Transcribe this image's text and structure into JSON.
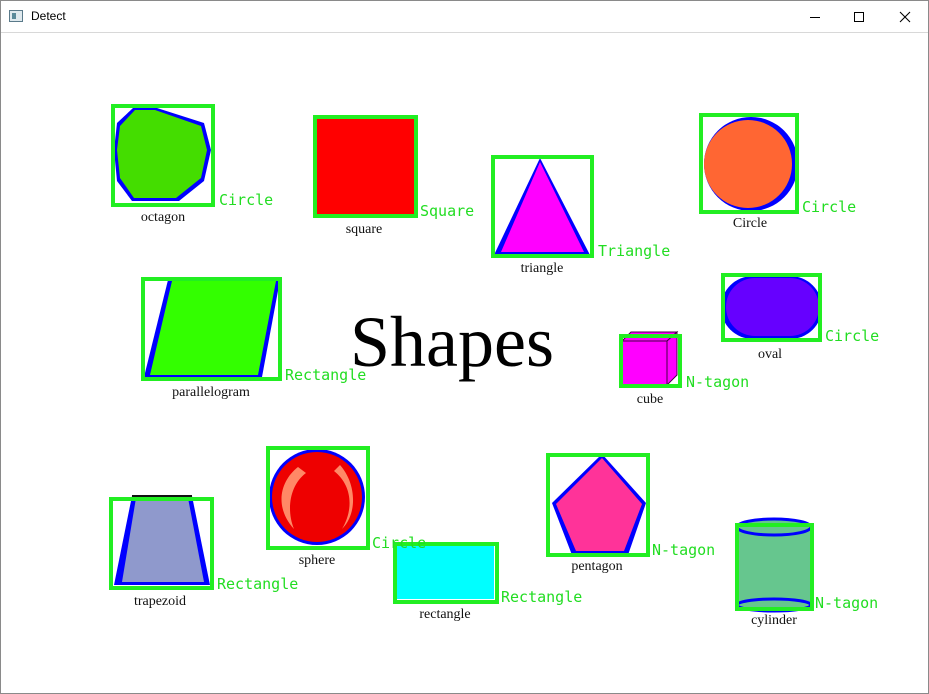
{
  "window": {
    "title": "Detect",
    "controls": [
      "minimize",
      "maximize",
      "close"
    ]
  },
  "canvas": {
    "heading": "Shapes",
    "shapes": [
      {
        "name": "octagon",
        "label": "octagon",
        "detection": "Circle",
        "color": "#44dd00"
      },
      {
        "name": "square",
        "label": "square",
        "detection": "Square",
        "color": "#ff0000"
      },
      {
        "name": "triangle",
        "label": "triangle",
        "detection": "Triangle",
        "color": "#ff00ff"
      },
      {
        "name": "circle",
        "label": "Circle",
        "detection": "Circle",
        "color": "#ff6633"
      },
      {
        "name": "parallelogram",
        "label": "parallelogram",
        "detection": "Rectangle",
        "color": "#33ff00"
      },
      {
        "name": "oval",
        "label": "oval",
        "detection": "Circle",
        "color": "#6600ff"
      },
      {
        "name": "cube",
        "label": "cube",
        "detection": "N-tagon",
        "color": "#ff00ff"
      },
      {
        "name": "sphere",
        "label": "sphere",
        "detection": "Circle",
        "color": "#ee0000"
      },
      {
        "name": "pentagon",
        "label": "pentagon",
        "detection": "N-tagon",
        "color": "#ff3399"
      },
      {
        "name": "trapezoid",
        "label": "trapezoid",
        "detection": "Rectangle",
        "color": "#8f99cc"
      },
      {
        "name": "rectangle",
        "label": "rectangle",
        "detection": "Rectangle",
        "color": "#00ffff"
      },
      {
        "name": "cylinder",
        "label": "cylinder",
        "detection": "N-tagon",
        "color": "#66c68e"
      }
    ],
    "outline_color": "#0000ff",
    "box_color": "#22ee22"
  }
}
